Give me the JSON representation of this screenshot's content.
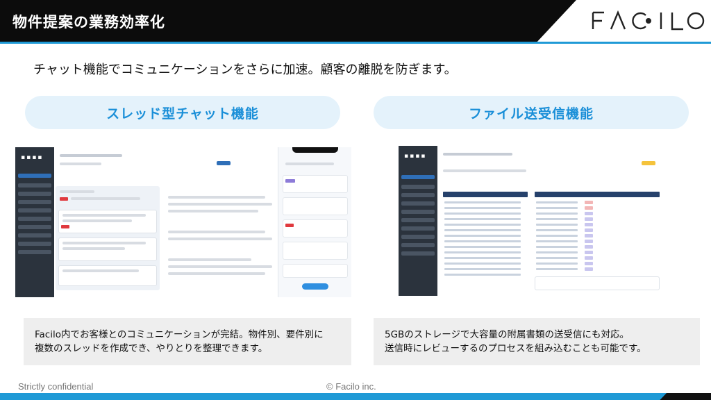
{
  "header": {
    "title": "物件提案の業務効率化",
    "logo_text": "FACILO"
  },
  "subtitle": "チャット機能でコミュニケーションをさらに加速。顧客の離脱を防ぎます。",
  "features": {
    "left": {
      "label": "スレッド型チャット機能",
      "description_lines": [
        "Facilo内でお客様とのコミュニケーションが完結。物件別、要件別に",
        "複数のスレッドを作成でき、やりとりを整理できます。"
      ]
    },
    "right": {
      "label": "ファイル送受信機能",
      "description_lines": [
        "5GBのストレージで大容量の附属書類の送受信にも対応。",
        "送信時にレビューするのプロセスを組み込むことも可能です。"
      ]
    }
  },
  "footer": {
    "confidential": "Strictly confidential",
    "copyright": "© Facilo inc."
  },
  "colors": {
    "accent": "#1f9ad6",
    "header_bg": "#0c0c0c",
    "pill_bg": "#e4f2fb",
    "pill_text": "#1a8fd8",
    "desc_bg": "#eeeeee"
  }
}
